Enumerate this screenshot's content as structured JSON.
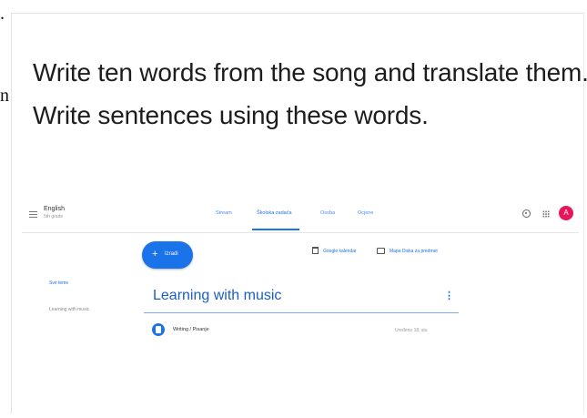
{
  "edge": {
    "dot": ".",
    "letter": "n"
  },
  "instructions": {
    "line1": "Write ten words from the song and translate them.",
    "line2": "Write sentences using these words."
  },
  "classroom": {
    "course_name": "English",
    "course_section": "5th grade",
    "tabs": [
      {
        "label": "Stream"
      },
      {
        "label": "Školska zadaća"
      },
      {
        "label": "Osoba"
      },
      {
        "label": "Ocjene"
      }
    ],
    "active_tab": "Školska zadaća",
    "avatar_letter": "A",
    "avatar_color": "#e5175a",
    "accent_color": "#1a73e8",
    "create_label": "Izradi",
    "google_calendar": "Google kalendar",
    "drive_folder": "Mapa Diska za predmet",
    "sidebar": {
      "all_topics": "Sve teme",
      "topic": "Learning with music"
    },
    "topic_title": "Learning with music",
    "more_icon": "⋮",
    "assignment": {
      "title": "Writing / Pisanje",
      "date": "Uređeno 18. stu"
    },
    "icons": [
      "menu-icon",
      "gear-icon",
      "apps-grid-icon",
      "calendar-icon",
      "folder-icon",
      "plus-icon",
      "assignment-icon",
      "more-vert-icon"
    ]
  }
}
